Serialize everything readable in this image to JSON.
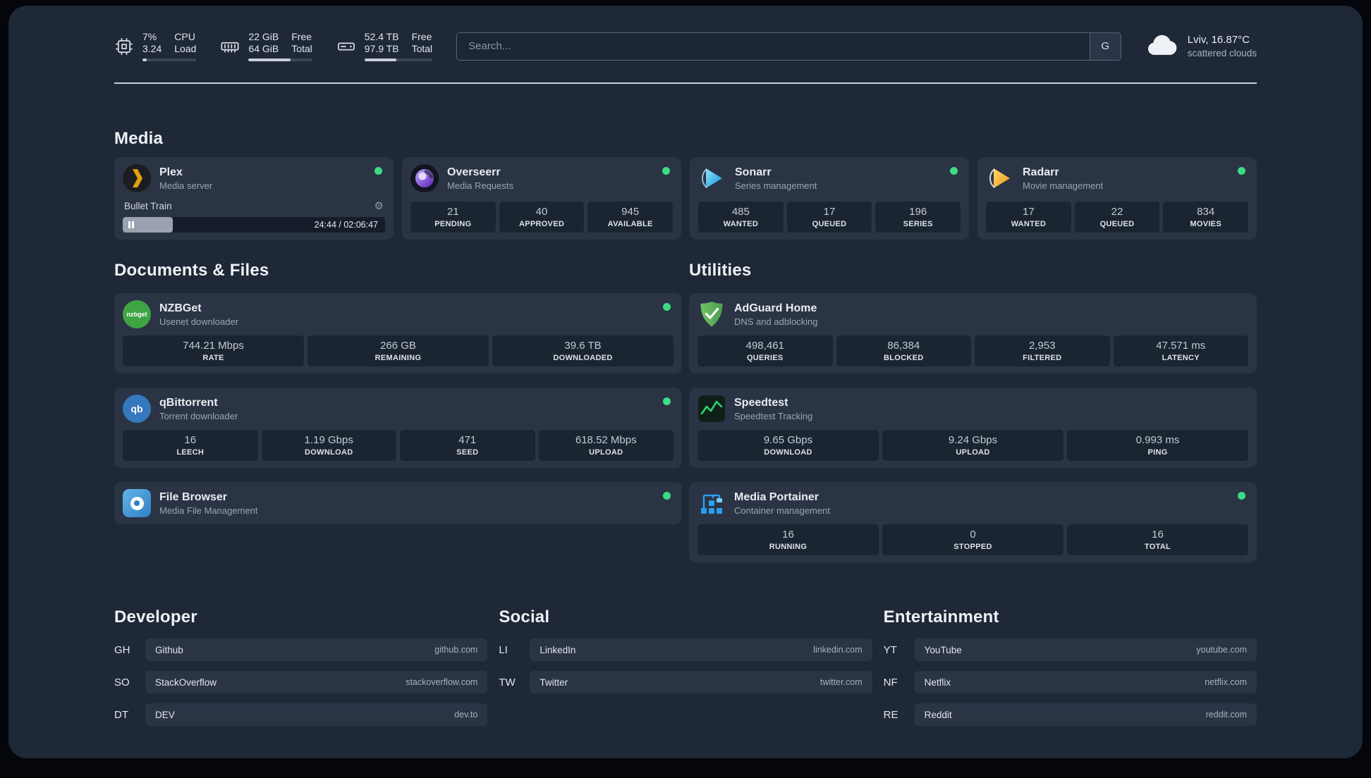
{
  "colors": {
    "status_online": "#3ddc84",
    "accent_plex": "#e5a00d",
    "accent_sonarr": "#35c5f4",
    "accent_radarr": "#f0a41c",
    "accent_adguard": "#5fae5c",
    "accent_speedtest": "#2dd36f",
    "accent_portainer": "#2a9ef0"
  },
  "topbar": {
    "cpu": {
      "value": "7%",
      "secondary": "3.24",
      "label_top": "CPU",
      "label_bottom": "Load",
      "bar_pct": 8
    },
    "memory": {
      "value": "22 GiB",
      "secondary": "64 GiB",
      "label_top": "Free",
      "label_bottom": "Total",
      "bar_pct": 66
    },
    "disk": {
      "value": "52.4 TB",
      "secondary": "97.9 TB",
      "label_top": "Free",
      "label_bottom": "Total",
      "bar_pct": 47
    },
    "search": {
      "placeholder": "Search...",
      "engine_button": "G"
    },
    "weather": {
      "location": "Lviv, 16.87°C",
      "condition": "scattered clouds"
    }
  },
  "media": {
    "title": "Media",
    "plex": {
      "name": "Plex",
      "subtitle": "Media server",
      "now_playing": "Bullet Train",
      "time": "24:44 / 02:06:47",
      "progress_pct": 19
    },
    "overseerr": {
      "name": "Overseerr",
      "subtitle": "Media Requests",
      "stats": [
        {
          "value": "21",
          "label": "PENDING"
        },
        {
          "value": "40",
          "label": "APPROVED"
        },
        {
          "value": "945",
          "label": "AVAILABLE"
        }
      ]
    },
    "sonarr": {
      "name": "Sonarr",
      "subtitle": "Series management",
      "stats": [
        {
          "value": "485",
          "label": "WANTED"
        },
        {
          "value": "17",
          "label": "QUEUED"
        },
        {
          "value": "196",
          "label": "SERIES"
        }
      ]
    },
    "radarr": {
      "name": "Radarr",
      "subtitle": "Movie management",
      "stats": [
        {
          "value": "17",
          "label": "WANTED"
        },
        {
          "value": "22",
          "label": "QUEUED"
        },
        {
          "value": "834",
          "label": "MOVIES"
        }
      ]
    }
  },
  "documents": {
    "title": "Documents & Files",
    "nzbget": {
      "name": "NZBGet",
      "subtitle": "Usenet downloader",
      "icon_text": "nzbget",
      "stats": [
        {
          "value": "744.21 Mbps",
          "label": "RATE"
        },
        {
          "value": "266 GB",
          "label": "REMAINING"
        },
        {
          "value": "39.6 TB",
          "label": "DOWNLOADED"
        }
      ]
    },
    "qbittorrent": {
      "name": "qBittorrent",
      "subtitle": "Torrent downloader",
      "icon_text": "qb",
      "stats": [
        {
          "value": "16",
          "label": "LEECH"
        },
        {
          "value": "1.19 Gbps",
          "label": "DOWNLOAD"
        },
        {
          "value": "471",
          "label": "SEED"
        },
        {
          "value": "618.52 Mbps",
          "label": "UPLOAD"
        }
      ]
    },
    "filebrowser": {
      "name": "File Browser",
      "subtitle": "Media File Management"
    }
  },
  "utilities": {
    "title": "Utilities",
    "adguard": {
      "name": "AdGuard Home",
      "subtitle": "DNS and adblocking",
      "stats": [
        {
          "value": "498,461",
          "label": "QUERIES"
        },
        {
          "value": "86,384",
          "label": "BLOCKED"
        },
        {
          "value": "2,953",
          "label": "FILTERED"
        },
        {
          "value": "47.571 ms",
          "label": "LATENCY"
        }
      ]
    },
    "speedtest": {
      "name": "Speedtest",
      "subtitle": "Speedtest Tracking",
      "stats": [
        {
          "value": "9.65 Gbps",
          "label": "DOWNLOAD"
        },
        {
          "value": "9.24 Gbps",
          "label": "UPLOAD"
        },
        {
          "value": "0.993 ms",
          "label": "PING"
        }
      ]
    },
    "portainer": {
      "name": "Media Portainer",
      "subtitle": "Container management",
      "stats": [
        {
          "value": "16",
          "label": "RUNNING"
        },
        {
          "value": "0",
          "label": "STOPPED"
        },
        {
          "value": "16",
          "label": "TOTAL"
        }
      ]
    }
  },
  "bookmarks": {
    "developer": {
      "title": "Developer",
      "items": [
        {
          "abbr": "GH",
          "name": "Github",
          "domain": "github.com"
        },
        {
          "abbr": "SO",
          "name": "StackOverflow",
          "domain": "stackoverflow.com"
        },
        {
          "abbr": "DT",
          "name": "DEV",
          "domain": "dev.to"
        }
      ]
    },
    "social": {
      "title": "Social",
      "items": [
        {
          "abbr": "LI",
          "name": "LinkedIn",
          "domain": "linkedin.com"
        },
        {
          "abbr": "TW",
          "name": "Twitter",
          "domain": "twitter.com"
        }
      ]
    },
    "entertainment": {
      "title": "Entertainment",
      "items": [
        {
          "abbr": "YT",
          "name": "YouTube",
          "domain": "youtube.com"
        },
        {
          "abbr": "NF",
          "name": "Netflix",
          "domain": "netflix.com"
        },
        {
          "abbr": "RE",
          "name": "Reddit",
          "domain": "reddit.com"
        }
      ]
    }
  }
}
